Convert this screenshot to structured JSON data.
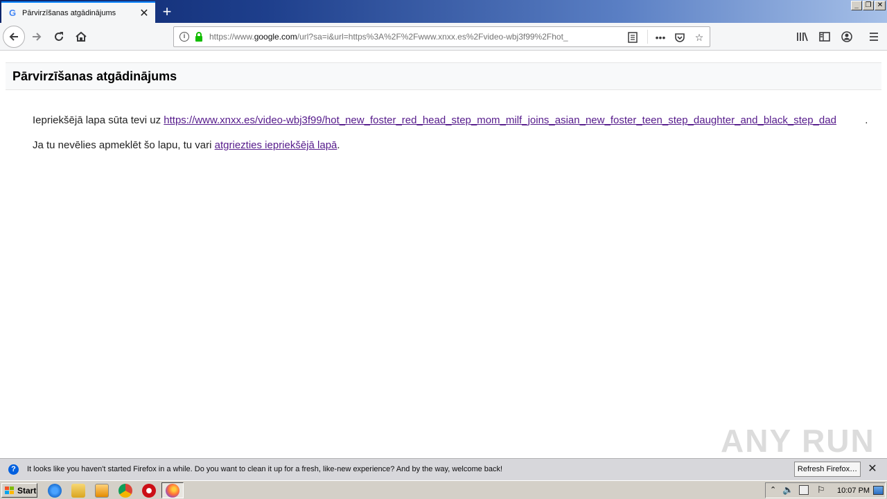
{
  "browser": {
    "tab": {
      "title": "Pārvirzīšanas atgādinājums",
      "favicon": "G"
    },
    "url": {
      "prefix": "https://www.",
      "host": "google.com",
      "rest": "/url?sa=i&url=https%3A%2F%2Fwww.xnxx.es%2Fvideo-wbj3f99%2Fhot_"
    }
  },
  "page": {
    "heading": "Pārvirzīšanas atgādinājums",
    "line1_prefix": "Iepriekšējā lapa sūta tevi uz ",
    "line1_link": "https://www.xnxx.es/video-wbj3f99/hot_new_foster_red_head_step_mom_milf_joins_asian_new_foster_teen_step_daughter_and_black_step_dad",
    "line1_suffix": ".",
    "line2_prefix": "Ja tu nevēlies apmeklēt šo lapu, tu vari ",
    "line2_link": "atgriezties iepriekšējā lapā",
    "line2_suffix": "."
  },
  "watermark": "ANY RUN",
  "notification": {
    "message": "It looks like you haven't started Firefox in a while. Do you want to clean it up for a fresh, like-new experience? And by the way, welcome back!",
    "button": "Refresh Firefox…"
  },
  "taskbar": {
    "start_label": "Start",
    "clock": "10:07 PM"
  }
}
